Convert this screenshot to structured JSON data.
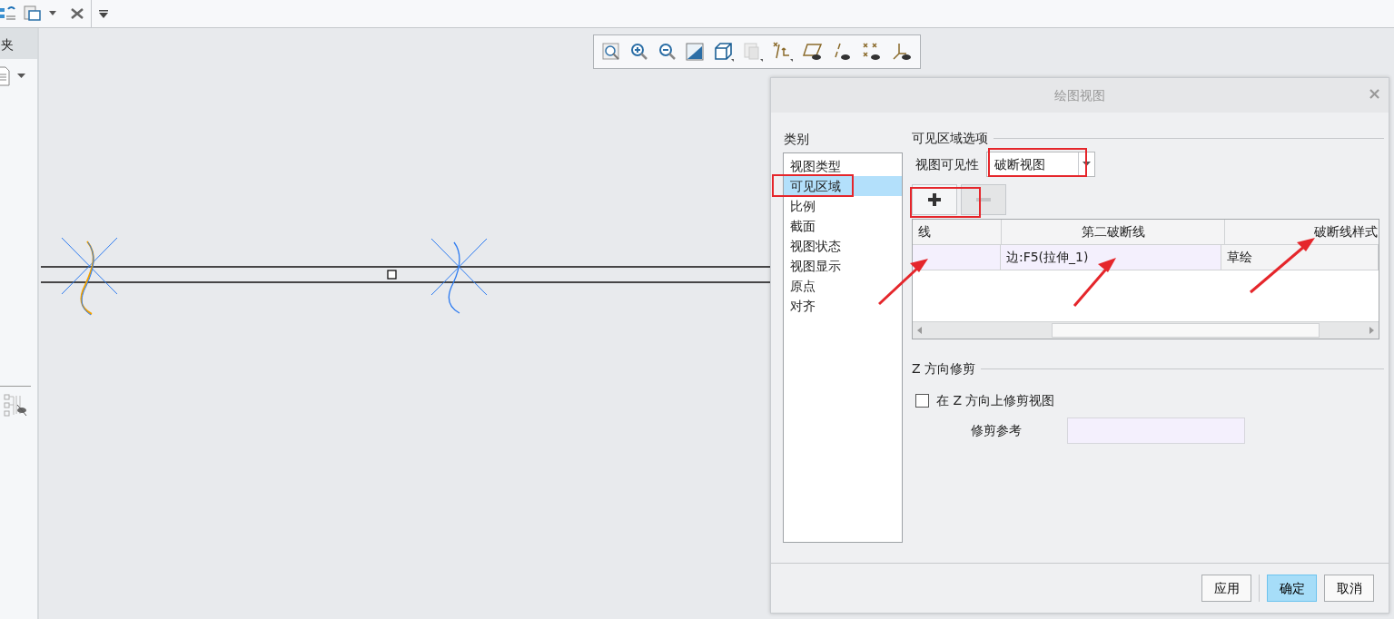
{
  "left_panel": {
    "header": "夹"
  },
  "dialog": {
    "title": "绘图视图",
    "close": "×",
    "category_label": "类别",
    "categories": [
      {
        "label": "视图类型",
        "selected": false
      },
      {
        "label": "可见区域",
        "selected": true
      },
      {
        "label": "比例",
        "selected": false
      },
      {
        "label": "截面",
        "selected": false
      },
      {
        "label": "视图状态",
        "selected": false
      },
      {
        "label": "视图显示",
        "selected": false
      },
      {
        "label": "原点",
        "selected": false
      },
      {
        "label": "对齐",
        "selected": false
      }
    ],
    "section_title": "可见区域选项",
    "visibility": {
      "label": "视图可见性",
      "value": "破断视图"
    },
    "row_buttons": [
      {
        "kind": "add",
        "disabled": false
      },
      {
        "kind": "remove",
        "disabled": true
      }
    ],
    "table": {
      "columns": [
        "线",
        "第二破断线",
        "破断线样式"
      ],
      "rows": [
        {
          "column_2": "边:F5(拉伸_1)",
          "column_3": "草绘"
        }
      ]
    },
    "z_trim": {
      "title": "Z 方向修剪",
      "checkbox": {
        "label": "在 Z 方向上修剪视图",
        "checked": false
      },
      "reference_label": "修剪参考"
    },
    "buttons": [
      {
        "label": "应用",
        "default": false
      },
      {
        "label": "确定",
        "default": true
      },
      {
        "label": "取消",
        "default": false
      }
    ]
  }
}
